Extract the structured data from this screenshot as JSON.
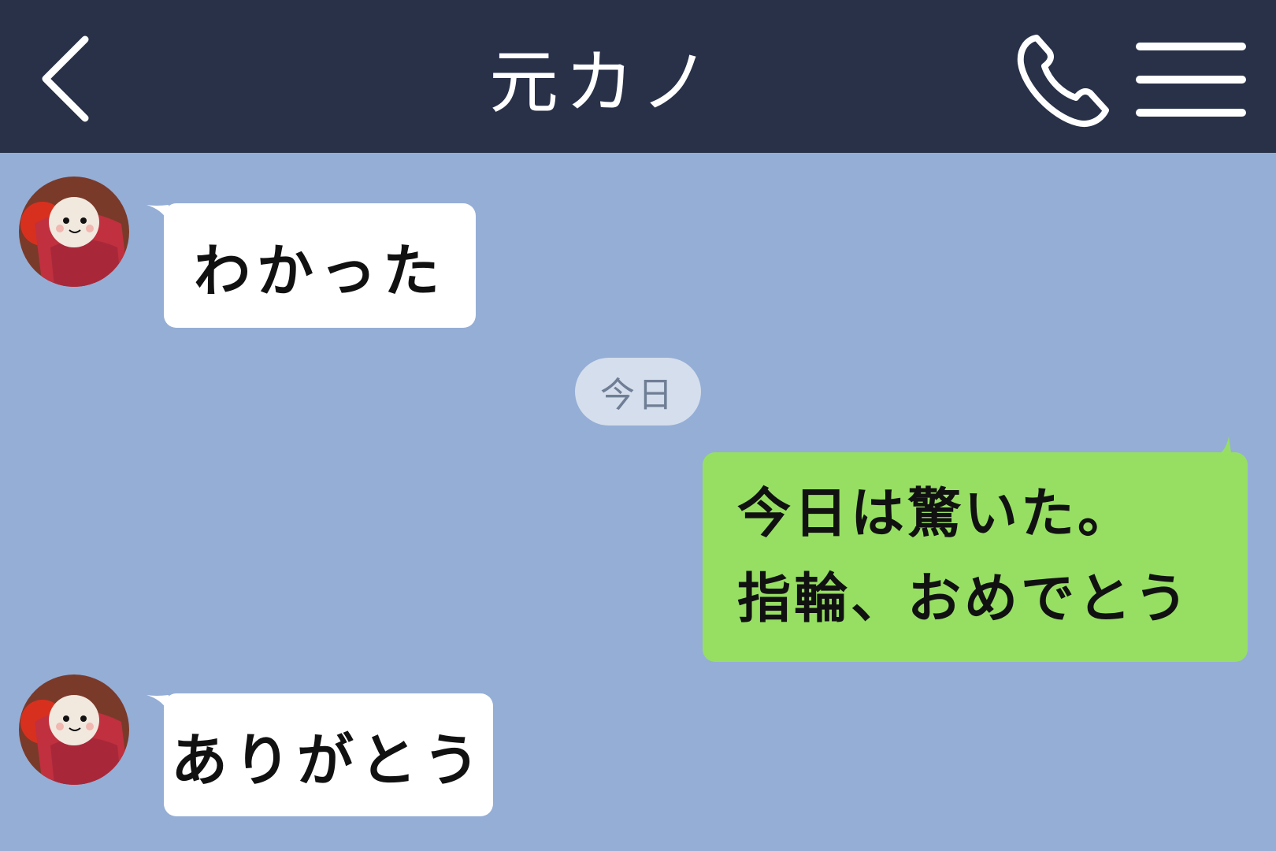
{
  "header": {
    "title": "元カノ",
    "back_icon": "chevron-left-icon",
    "call_icon": "phone-icon",
    "menu_icon": "hamburger-menu-icon"
  },
  "date_separator": "今日",
  "messages": [
    {
      "direction": "incoming",
      "text": "わかった"
    },
    {
      "direction": "outgoing",
      "lines": [
        "今日は驚いた。",
        "指輪、おめでとう"
      ]
    },
    {
      "direction": "incoming",
      "text": "ありがとう"
    }
  ],
  "colors": {
    "header_bg": "#283148",
    "chat_bg": "#95aed6",
    "outgoing_bubble": "#96df63",
    "incoming_bubble": "#ffffff",
    "date_pill": "#d5deec"
  }
}
